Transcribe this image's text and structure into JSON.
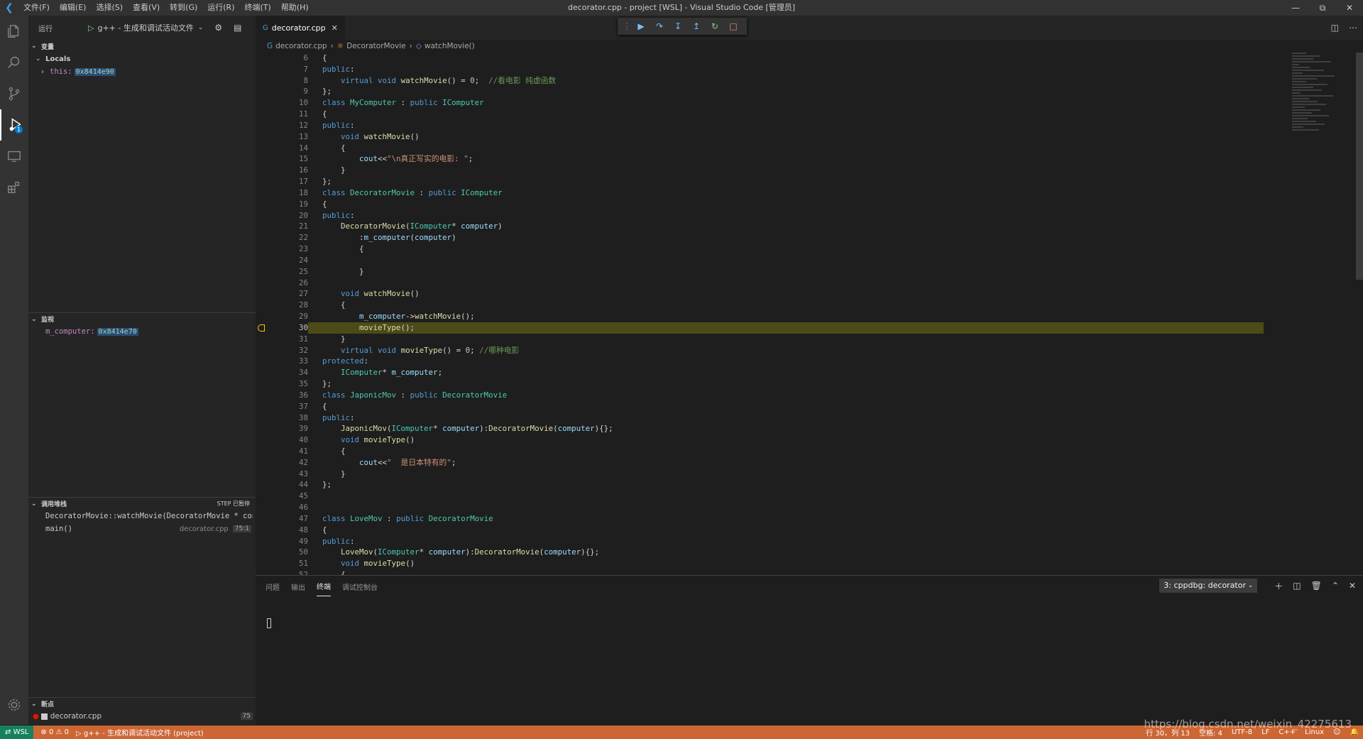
{
  "titlebar": {
    "menu": [
      "文件(F)",
      "编辑(E)",
      "选择(S)",
      "查看(V)",
      "转到(G)",
      "运行(R)",
      "终端(T)",
      "帮助(H)"
    ],
    "title": "decorator.cpp - project [WSL] - Visual Studio Code [管理员]"
  },
  "run": {
    "label": "运行",
    "config": "g++ - 生成和调试活动文件"
  },
  "variables": {
    "title": "变量",
    "locals_label": "Locals",
    "this_name": "this:",
    "this_value": "0x8414e90"
  },
  "watch": {
    "title": "监视",
    "item_name": "m_computer:",
    "item_value": "0x8414e70"
  },
  "callstack": {
    "title": "调用堆栈",
    "status": "STEP 已暂停",
    "frames": [
      {
        "name": "DecoratorMovie::watchMovie(DecoratorMovie * const",
        "file": "",
        "pos": ""
      },
      {
        "name": "main()",
        "file": "decorator.cpp",
        "pos": "75:1"
      }
    ]
  },
  "breakpoints": {
    "title": "断点",
    "item": "decorator.cpp",
    "count": "75"
  },
  "tab": {
    "name": "decorator.cpp"
  },
  "breadcrumb": [
    "decorator.cpp",
    "DecoratorMovie",
    "watchMovie()"
  ],
  "editor": {
    "current_line": 30
  },
  "panel": {
    "tabs": [
      "问题",
      "输出",
      "终端",
      "调试控制台"
    ],
    "active_tab": "终端",
    "terminal_select": "3: cppdbg: decorator"
  },
  "statusbar": {
    "remote": "WSL",
    "errors": "0",
    "warnings": "0",
    "debug": "g++ - 生成和调试活动文件 (project)",
    "position": "行 30，列 13",
    "spaces": "空格: 4",
    "encoding": "UTF-8",
    "eol": "LF",
    "language": "C++",
    "os": "Linux"
  },
  "watermark": "https://blog.csdn.net/weixin_42275613"
}
